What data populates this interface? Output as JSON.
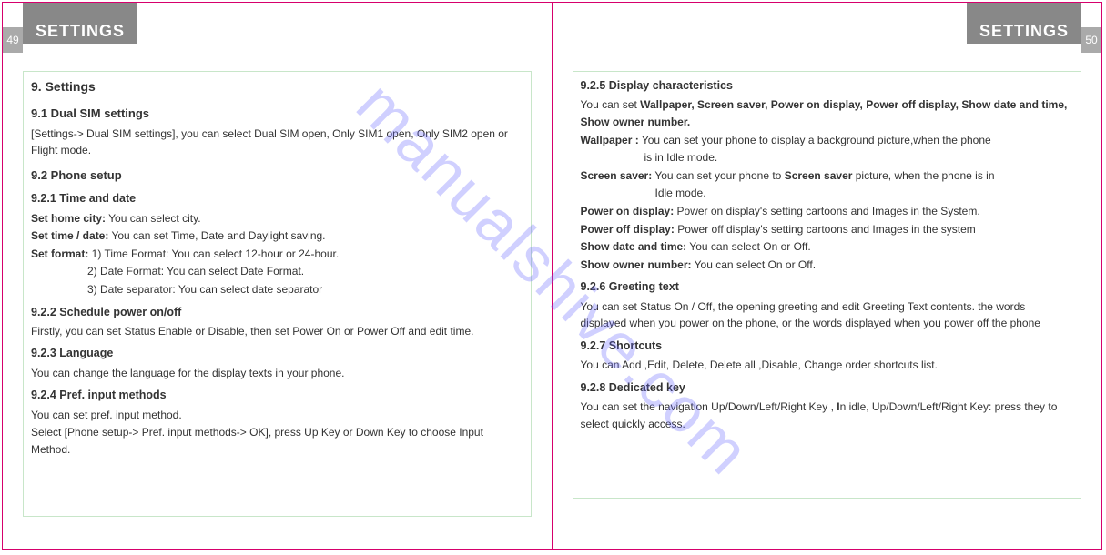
{
  "watermark": "manualshive.com",
  "left": {
    "page_num": "49",
    "tab": "SETTINGS",
    "h_main": "9. Settings",
    "s91_h": "9.1 Dual SIM settings",
    "s91_p": "[Settings-> Dual SIM settings], you can select Dual SIM open, Only SIM1 open, Only SIM2 open or Flight mode.",
    "s92_h": "9.2 Phone setup",
    "s921_h": "9.2.1 Time and date",
    "s921_city_b": "Set home city:",
    "s921_city_t": " You can select city.",
    "s921_td_b": "Set time / date:",
    "s921_td_t": " You can set Time, Date and Daylight saving.",
    "s921_fmt_b": "Set format:",
    "s921_fmt_t": " 1) Time Format: You can select 12-hour or 24-hour.",
    "s921_fmt2": "2) Date Format: You can select Date Format.",
    "s921_fmt3": "3) Date separator: You can select date separator",
    "s922_h": "9.2.2 Schedule power on/off",
    "s922_p": "Firstly, you can set Status Enable or Disable, then set Power On or Power Off and edit time.",
    "s923_h": "9.2.3 Language",
    "s923_p": "You can change the language for the display texts in your phone.",
    "s924_h": "9.2.4 Pref. input methods",
    "s924_p1": "You can set pref. input method.",
    "s924_p2": "Select [Phone setup-> Pref. input methods-> OK], press Up Key or Down Key to choose Input Method."
  },
  "right": {
    "page_num": "50",
    "tab": "SETTINGS",
    "s925_h": "9.2.5 Display characteristics",
    "s925_intro1": "You can set ",
    "s925_intro_b": "Wallpaper, Screen saver, Power on display, Power off display, Show date and time, Show owner number.",
    "s925_wp_b": "Wallpaper :",
    "s925_wp_t": " You can set your phone to display a background picture,when the phone",
    "s925_wp2": "is in Idle mode.",
    "s925_ss_b": "Screen saver:",
    "s925_ss_t1": " You can set your phone to ",
    "s925_ss_b2": "Screen saver",
    "s925_ss_t2": " picture, when the phone is in",
    "s925_ss2": "Idle mode.",
    "s925_pon_b": "Power on display:",
    "s925_pon_t": " Power on display's setting cartoons and Images in the System.",
    "s925_poff_b": "Power off display:",
    "s925_poff_t": " Power off display's setting cartoons and Images in the system",
    "s925_dt_b": "Show date and time:",
    "s925_dt_t": " You can select On or Off.",
    "s925_on_b": "Show owner number:",
    "s925_on_t": " You can select On or Off.",
    "s926_h": "9.2.6 Greeting text",
    "s926_p": "You can set Status On / Off, the opening greeting and edit Greeting Text contents. the words displayed when you power on the phone, or the words displayed when you power off the phone",
    "s927_h": "9.2.7 Shortcuts",
    "s927_p": "You can Add ,Edit, Delete, Delete all ,Disable, Change order shortcuts list.",
    "s928_h": "9.2.8 Dedicated key",
    "s928_p1": "You can set the navigation Up/Down/Left/Right Key ,  ",
    "s928_b": "I",
    "s928_p2": "n idle, Up/Down/Left/Right Key: press they to select quickly access."
  }
}
